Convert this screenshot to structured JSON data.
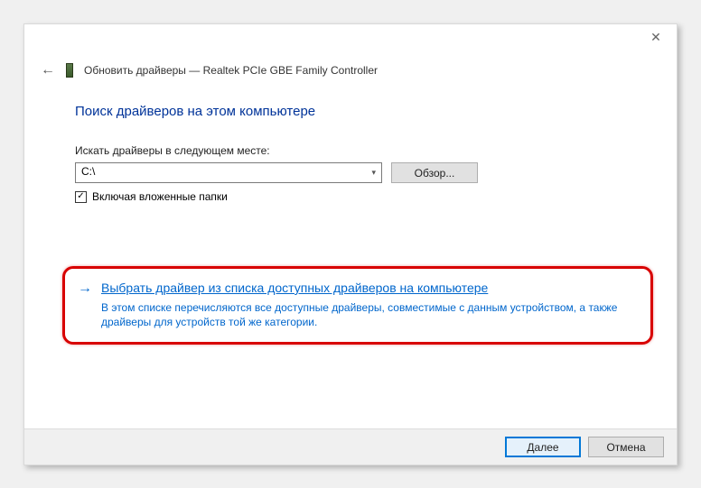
{
  "window": {
    "title": "Обновить драйверы — Realtek PCIe GBE Family Controller",
    "close_glyph": "✕",
    "back_glyph": "←"
  },
  "heading": "Поиск драйверов на этом компьютере",
  "search": {
    "label": "Искать драйверы в следующем месте:",
    "path_value": "C:\\",
    "browse_label": "Обзор...",
    "checkbox_checked_glyph": "✓",
    "checkbox_label": "Включая вложенные папки"
  },
  "command": {
    "arrow_glyph": "→",
    "title": "Выбрать драйвер из списка доступных драйверов на компьютере",
    "description": "В этом списке перечисляются все доступные драйверы, совместимые с данным устройством, а также драйверы для устройств той же категории."
  },
  "footer": {
    "next_label": "Далее",
    "cancel_label": "Отмена"
  }
}
